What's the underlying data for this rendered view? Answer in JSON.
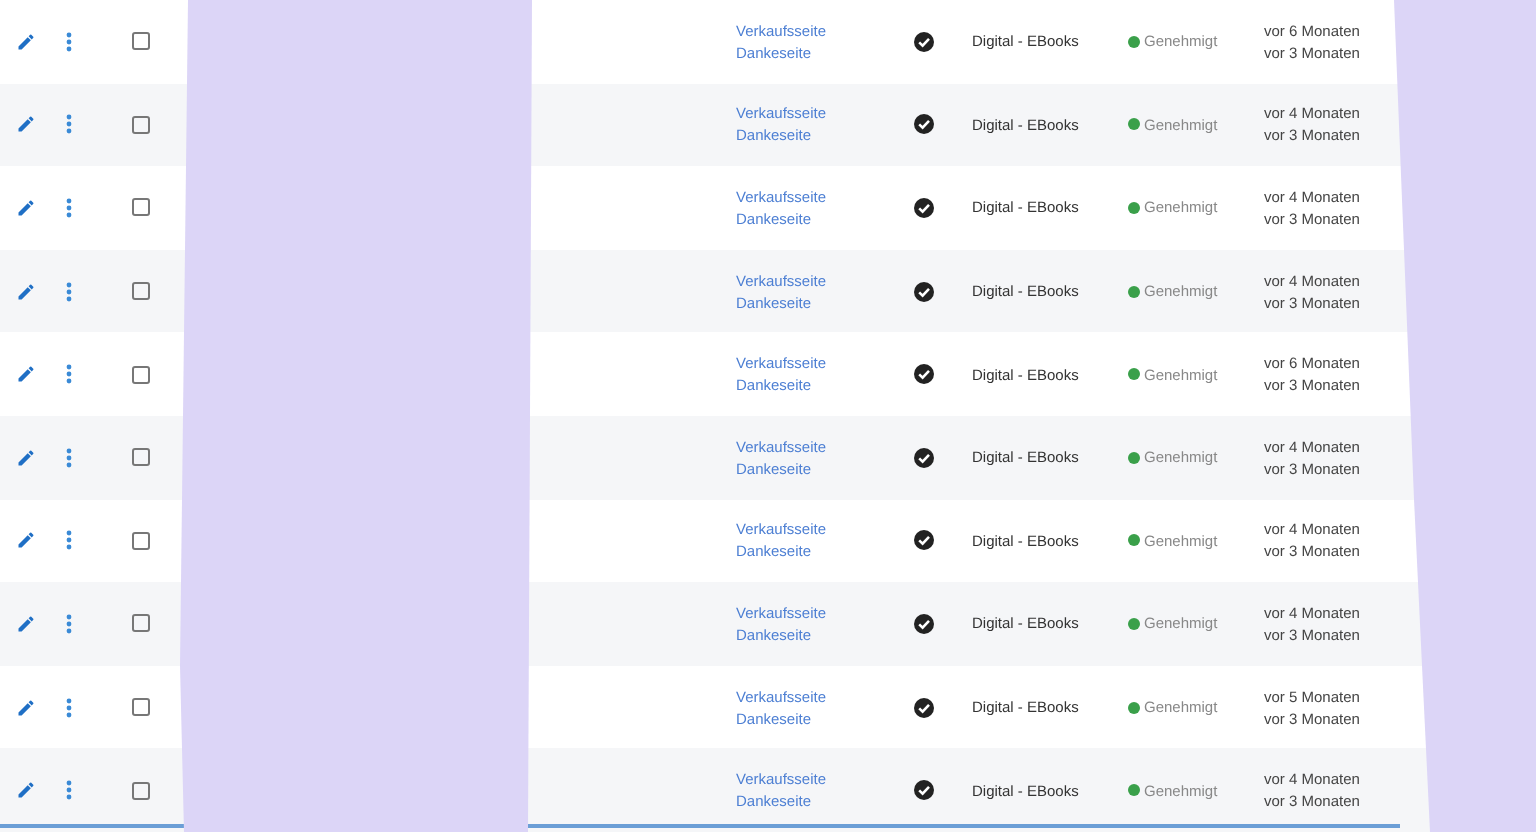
{
  "rows": [
    {
      "checked": false,
      "links": [
        "Verkaufsseite",
        "Dankeseite"
      ],
      "category": "Digital - EBooks",
      "status": {
        "label": "Genehmigt",
        "color": "#3aa04a"
      },
      "dates": [
        "vor 6 Monaten",
        "vor 3 Monaten"
      ]
    },
    {
      "checked": false,
      "links": [
        "Verkaufsseite",
        "Dankeseite"
      ],
      "category": "Digital - EBooks",
      "status": {
        "label": "Genehmigt",
        "color": "#3aa04a"
      },
      "dates": [
        "vor 4 Monaten",
        "vor 3 Monaten"
      ]
    },
    {
      "checked": false,
      "links": [
        "Verkaufsseite",
        "Dankeseite"
      ],
      "category": "Digital - EBooks",
      "status": {
        "label": "Genehmigt",
        "color": "#3aa04a"
      },
      "dates": [
        "vor 4 Monaten",
        "vor 3 Monaten"
      ]
    },
    {
      "checked": false,
      "links": [
        "Verkaufsseite",
        "Dankeseite"
      ],
      "category": "Digital - EBooks",
      "status": {
        "label": "Genehmigt",
        "color": "#3aa04a"
      },
      "dates": [
        "vor 4 Monaten",
        "vor 3 Monaten"
      ]
    },
    {
      "checked": false,
      "links": [
        "Verkaufsseite",
        "Dankeseite"
      ],
      "category": "Digital - EBooks",
      "status": {
        "label": "Genehmigt",
        "color": "#3aa04a"
      },
      "dates": [
        "vor 6 Monaten",
        "vor 3 Monaten"
      ]
    },
    {
      "checked": false,
      "links": [
        "Verkaufsseite",
        "Dankeseite"
      ],
      "category": "Digital - EBooks",
      "status": {
        "label": "Genehmigt",
        "color": "#3aa04a"
      },
      "dates": [
        "vor 4 Monaten",
        "vor 3 Monaten"
      ]
    },
    {
      "checked": false,
      "links": [
        "Verkaufsseite",
        "Dankeseite"
      ],
      "category": "Digital - EBooks",
      "status": {
        "label": "Genehmigt",
        "color": "#3aa04a"
      },
      "dates": [
        "vor 4 Monaten",
        "vor 3 Monaten"
      ]
    },
    {
      "checked": false,
      "links": [
        "Verkaufsseite",
        "Dankeseite"
      ],
      "category": "Digital - EBooks",
      "status": {
        "label": "Genehmigt",
        "color": "#3aa04a"
      },
      "dates": [
        "vor 4 Monaten",
        "vor 3 Monaten"
      ]
    },
    {
      "checked": false,
      "links": [
        "Verkaufsseite",
        "Dankeseite"
      ],
      "category": "Digital - EBooks",
      "status": {
        "label": "Genehmigt",
        "color": "#3aa04a"
      },
      "dates": [
        "vor 5 Monaten",
        "vor 3 Monaten"
      ]
    },
    {
      "checked": false,
      "links": [
        "Verkaufsseite",
        "Dankeseite"
      ],
      "category": "Digital - EBooks",
      "status": {
        "label": "Genehmigt",
        "color": "#3aa04a"
      },
      "dates": [
        "vor 4 Monaten",
        "vor 3 Monaten"
      ]
    }
  ]
}
